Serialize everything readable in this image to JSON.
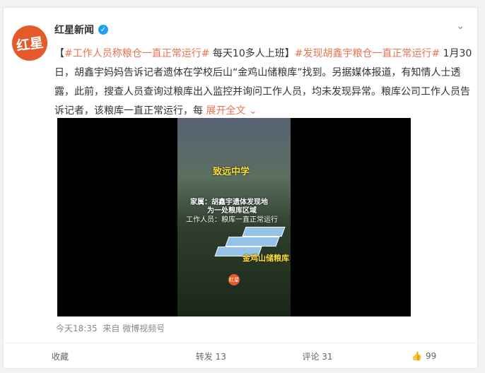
{
  "header": {
    "name": "红星新闻",
    "avatar_text": "红星",
    "more": "⌄"
  },
  "post": {
    "prefix": "【",
    "hashtag1": "#工作人员称粮仓一直正常运行#",
    "text1": " 每天10多人上班】",
    "hashtag2": "#发现胡鑫宇粮仓一直正常运行#",
    "text2": " 1月30日，胡鑫宇妈妈告诉记者遗体在学校后山“金鸡山储粮库”找到。另据媒体报道，有知情人士透露，此前，搜查人员查询过粮库出入监控并询问工作人员，均未发现异常。粮库公司工作人员告诉记者，该粮库一直正常运行，每",
    "expand": "展开全文"
  },
  "video": {
    "school_label": "致远中学",
    "caption1": "家属：胡鑫宇遗体发现地",
    "caption2": "为一处粮库区域",
    "caption3": "工作人员：粮库一直正常运行",
    "warehouse_label": "金鸡山储粮库",
    "watermark": "红星"
  },
  "meta": {
    "time": "今天18:35",
    "source_prefix": "来自",
    "source": "微博视频号"
  },
  "actions": {
    "favorite": "收藏",
    "repost": "转发 13",
    "comment": "评论 31",
    "like": "99"
  },
  "colors": {
    "accent": "#eb7350",
    "brand": "#e45a2a"
  }
}
